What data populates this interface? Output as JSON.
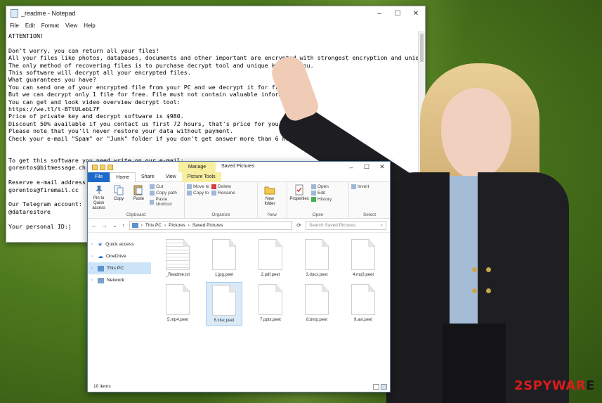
{
  "notepad": {
    "title": "_readme - Notepad",
    "menu": [
      "File",
      "Edit",
      "Format",
      "View",
      "Help"
    ],
    "controls": [
      "–",
      "☐",
      "✕"
    ],
    "body": "ATTENTION!\n\nDon't worry, you can return all your files!\nAll your files like photos, databases, documents and other important are encrypted with strongest encryption and unique key.\nThe only method of recovering files is to purchase decrypt tool and unique key for you.\nThis software will decrypt all your encrypted files.\nWhat guarantees you have?\nYou can send one of your encrypted file from your PC and we decrypt it for free.\nBut we can decrypt only 1 file for free. File must not contain valuable information.\nYou can get and look video overview decrypt tool:\nhttps://we.tl/t-BTtULebL7F\nPrice of private key and decrypt software is $980.\nDiscount 50% available if you contact us first 72 hours, that's price for you is $490.\nPlease note that you'll never restore your data without payment.\nCheck your e-mail \"Spam\" or \"Junk\" folder if you don't get answer more than 6 hours.\n\n\nTo get this software you need write on our e-mail:\ngorentos@bitmessage.ch\n\nReserve e-mail address to contact us:\ngorentos@firemail.cc\n\nOur Telegram account:\n@datarestore\n\nYour personal ID:|"
  },
  "explorer": {
    "manage_tab": "Manage",
    "title": "Saved Pictures",
    "controls": [
      "–",
      "☐",
      "✕"
    ],
    "tabs": {
      "file": "File",
      "home": "Home",
      "share": "Share",
      "view": "View",
      "picture_tools": "Picture Tools"
    },
    "ribbon": {
      "clipboard": {
        "label": "Clipboard",
        "pin": "Pin to Quick access",
        "copy": "Copy",
        "paste": "Paste",
        "cut": "Cut",
        "copy_path": "Copy path",
        "paste_shortcut": "Paste shortcut"
      },
      "organize": {
        "label": "Organize",
        "move_to": "Move to",
        "copy_to": "Copy to",
        "delete": "Delete",
        "rename": "Rename"
      },
      "new": {
        "label": "New",
        "new_folder": "New folder"
      },
      "open": {
        "label": "Open",
        "properties": "Properties",
        "open": "Open",
        "edit": "Edit",
        "history": "History"
      },
      "select": {
        "label": "Select",
        "invert": "Invert"
      }
    },
    "address": {
      "path": [
        "This PC",
        "Pictures",
        "Saved Pictures"
      ],
      "separator": "›",
      "search_placeholder": "Search Saved Pictures"
    },
    "nav": [
      {
        "label": "Quick access"
      },
      {
        "label": "OneDrive"
      },
      {
        "label": "This PC"
      },
      {
        "label": "Network"
      }
    ],
    "files": [
      "_Readme.txt",
      "1.jpg.peet",
      "2.pdf.peet",
      "3.docx.peet",
      "4.mp3.peet",
      "5.mp4.peet",
      "6.xlsx.peet",
      "7.pptx.peet",
      "8.bmp.peet",
      "9.avi.peet"
    ],
    "status": "10 items"
  },
  "watermark": {
    "part1": "2SPYWAR",
    "part2": "E"
  },
  "colors": {
    "file_tab": "#1b6ac9",
    "picture_tools": "#f8eea0",
    "watermark_red": "#d91c1c"
  }
}
